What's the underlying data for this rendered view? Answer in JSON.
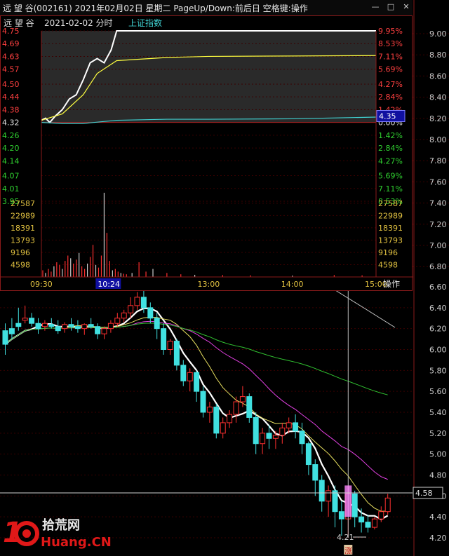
{
  "window": {
    "title": "远 望 谷(002161) 2021年02月02日 星期二 PageUp/Down:前后日 空格键:操作",
    "minimize_icon": "minimize-icon",
    "restore_icon": "restore-icon",
    "close_icon": "close-icon"
  },
  "popup": {
    "header_name": "远 望 谷",
    "header_date": "2021-02-02 分时",
    "header_index": "上证指数",
    "price_label": "4.35",
    "operate_button": "操作",
    "cursor_time": "10:24",
    "colors": {
      "price_line": "#ffffff",
      "avg_line": "#ffff40",
      "index_line": "#40d0d0",
      "volume_bar": "#ff3030",
      "up": "#ff3030",
      "down": "#00c000"
    }
  },
  "chart_data": [
    {
      "type": "line",
      "title": "",
      "x_ticks": [
        "09:30",
        "10:24",
        "13:00",
        "14:00",
        "15:00"
      ],
      "y_left_ticks": [
        "4.75",
        "4.69",
        "4.63",
        "4.57",
        "4.50",
        "4.44",
        "4.38",
        "4.32",
        "4.26",
        "4.20",
        "4.14",
        "4.07",
        "4.01",
        "3.95"
      ],
      "y_right_ticks": [
        "9.95%",
        "8.53%",
        "7.11%",
        "5.69%",
        "4.27%",
        "2.84%",
        "1.42%",
        "0.00%",
        "1.42%",
        "2.84%",
        "4.27%",
        "5.69%",
        "7.11%",
        "8.53%"
      ],
      "ylim": [
        3.95,
        4.75
      ],
      "prev_close": 4.32,
      "series": [
        {
          "name": "price",
          "x": [
            "09:30",
            "09:33",
            "09:36",
            "09:40",
            "09:45",
            "09:50",
            "09:55",
            "10:00",
            "10:05",
            "10:10",
            "10:15",
            "10:20",
            "10:24",
            "15:00"
          ],
          "values": [
            4.33,
            4.34,
            4.32,
            4.35,
            4.38,
            4.43,
            4.45,
            4.52,
            4.6,
            4.62,
            4.6,
            4.66,
            4.75,
            4.75
          ]
        },
        {
          "name": "average",
          "x": [
            "09:30",
            "09:45",
            "10:00",
            "10:10",
            "10:24",
            "11:00",
            "13:00",
            "14:00",
            "15:00"
          ],
          "values": [
            4.33,
            4.36,
            4.45,
            4.55,
            4.61,
            4.625,
            4.63,
            4.632,
            4.634
          ]
        },
        {
          "name": "上证指数",
          "x": [
            "09:30",
            "09:45",
            "10:00",
            "10:24",
            "11:00",
            "13:00",
            "14:00",
            "15:00"
          ],
          "values": [
            4.32,
            4.315,
            4.315,
            4.33,
            4.335,
            4.335,
            4.337,
            4.345
          ]
        }
      ]
    },
    {
      "type": "bar",
      "title": "",
      "y_ticks": [
        "27587",
        "22989",
        "18391",
        "13793",
        "9196",
        "4598"
      ],
      "ylim": [
        0,
        32000
      ],
      "x": [
        "09:31",
        "09:33",
        "09:35",
        "09:37",
        "09:39",
        "09:41",
        "09:43",
        "09:45",
        "09:47",
        "09:49",
        "09:51",
        "09:53",
        "09:55",
        "09:57",
        "09:59",
        "10:01",
        "10:03",
        "10:05",
        "10:07",
        "10:09",
        "10:11",
        "10:13",
        "10:15",
        "10:17",
        "10:19",
        "10:21",
        "10:23",
        "10:25",
        "10:27",
        "10:29",
        "10:31",
        "10:35",
        "10:40",
        "10:45",
        "10:50",
        "11:00",
        "11:10",
        "11:20",
        "13:10",
        "13:30",
        "14:00",
        "14:30",
        "14:50"
      ],
      "values": [
        2500,
        1500,
        3000,
        2000,
        4000,
        5500,
        4500,
        3000,
        6000,
        8000,
        7000,
        5000,
        6500,
        9000,
        4000,
        3000,
        5000,
        7500,
        12000,
        4500,
        3500,
        8000,
        31500,
        16500,
        6000,
        2500,
        3000,
        2000,
        1500,
        1200,
        1000,
        1500,
        5500,
        2000,
        3000,
        1500,
        1000,
        800,
        700,
        600,
        500,
        700,
        600
      ]
    },
    {
      "type": "candlestick",
      "title": "",
      "y_ticks": [
        "6.60",
        "6.40",
        "6.20",
        "6.00",
        "5.80",
        "5.60",
        "5.40",
        "5.20",
        "5.00",
        "4.80",
        "4.60",
        "4.40",
        "4.20"
      ],
      "y_left_ticks": [
        "9.00",
        "8.80",
        "8.60",
        "8.40",
        "8.20",
        "8.00",
        "7.80",
        "7.60",
        "7.40",
        "7.20",
        "7.00",
        "6.80"
      ],
      "ylim": [
        4.18,
        9.35
      ],
      "current_price": "4.58",
      "low_label": "4.21",
      "event_marker": "涨",
      "candles": [
        [
          6.18,
          6.25,
          6.05,
          5.95
        ],
        [
          6.2,
          6.3,
          6.15,
          6.1
        ],
        [
          6.25,
          6.4,
          6.22,
          6.18
        ],
        [
          6.28,
          6.42,
          6.3,
          6.25
        ],
        [
          6.3,
          6.35,
          6.25,
          6.22
        ],
        [
          6.25,
          6.3,
          6.2,
          6.15
        ],
        [
          6.22,
          6.28,
          6.25,
          6.18
        ],
        [
          6.24,
          6.3,
          6.22,
          6.2
        ],
        [
          6.22,
          6.28,
          6.18,
          6.15
        ],
        [
          6.2,
          6.26,
          6.24,
          6.16
        ],
        [
          6.24,
          6.3,
          6.22,
          6.18
        ],
        [
          6.22,
          6.28,
          6.2,
          6.16
        ],
        [
          6.2,
          6.25,
          6.24,
          6.14
        ],
        [
          6.24,
          6.3,
          6.22,
          6.2
        ],
        [
          6.22,
          6.25,
          6.15,
          6.1
        ],
        [
          6.15,
          6.22,
          6.2,
          6.1
        ],
        [
          6.2,
          6.28,
          6.25,
          6.16
        ],
        [
          6.25,
          6.35,
          6.3,
          6.22
        ],
        [
          6.3,
          6.38,
          6.35,
          6.26
        ],
        [
          6.35,
          6.5,
          6.42,
          6.3
        ],
        [
          6.42,
          6.55,
          6.5,
          6.38
        ],
        [
          6.5,
          6.58,
          6.4,
          6.35
        ],
        [
          6.4,
          6.45,
          6.3,
          6.25
        ],
        [
          6.3,
          6.35,
          6.2,
          6.1
        ],
        [
          6.2,
          6.25,
          6.0,
          5.95
        ],
        [
          6.0,
          6.1,
          6.08,
          5.95
        ],
        [
          6.08,
          6.1,
          5.85,
          5.8
        ],
        [
          5.85,
          5.9,
          5.7,
          5.65
        ],
        [
          5.7,
          5.82,
          5.78,
          5.6
        ],
        [
          5.78,
          5.8,
          5.6,
          5.5
        ],
        [
          5.6,
          5.65,
          5.4,
          5.35
        ],
        [
          5.4,
          5.5,
          5.45,
          5.3
        ],
        [
          5.45,
          5.48,
          5.2,
          5.15
        ],
        [
          5.2,
          5.35,
          5.3,
          5.15
        ],
        [
          5.3,
          5.42,
          5.38,
          5.25
        ],
        [
          5.38,
          5.55,
          5.5,
          5.3
        ],
        [
          5.5,
          5.65,
          5.55,
          5.45
        ],
        [
          5.55,
          5.58,
          5.35,
          5.3
        ],
        [
          5.35,
          5.4,
          5.1,
          5.0
        ],
        [
          5.1,
          5.25,
          5.2,
          5.0
        ],
        [
          5.2,
          5.28,
          5.15,
          5.05
        ],
        [
          5.15,
          5.22,
          5.18,
          5.05
        ],
        [
          5.18,
          5.3,
          5.25,
          5.1
        ],
        [
          5.25,
          5.35,
          5.3,
          5.2
        ],
        [
          5.3,
          5.38,
          5.22,
          5.15
        ],
        [
          5.22,
          5.3,
          5.1,
          5.0
        ],
        [
          5.1,
          5.12,
          4.9,
          4.8
        ],
        [
          4.9,
          4.95,
          4.75,
          4.6
        ],
        [
          4.75,
          4.8,
          4.55,
          4.45
        ],
        [
          4.55,
          4.7,
          4.65,
          4.4
        ],
        [
          4.65,
          4.7,
          4.45,
          4.3
        ],
        [
          4.45,
          4.55,
          4.38,
          4.22
        ],
        [
          4.38,
          4.7,
          4.62,
          4.21
        ],
        [
          4.62,
          4.65,
          4.4,
          4.3
        ],
        [
          4.4,
          4.48,
          4.35,
          4.25
        ],
        [
          4.35,
          4.42,
          4.3,
          4.25
        ],
        [
          4.3,
          4.4,
          4.38,
          4.28
        ],
        [
          4.38,
          4.5,
          4.45,
          4.35
        ],
        [
          4.45,
          4.62,
          4.58,
          4.42
        ]
      ]
    }
  ]
}
